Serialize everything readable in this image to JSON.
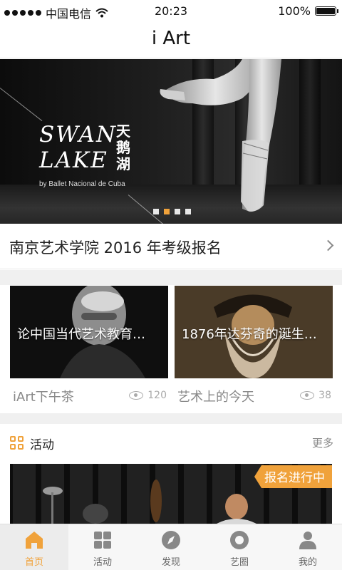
{
  "status_bar": {
    "carrier": "中国电信",
    "time": "20:23",
    "battery": "100%",
    "battery_level": 1.0
  },
  "nav": {
    "title": "i Art"
  },
  "banner": {
    "title_latin_line1": "SWAN",
    "title_latin_line2": "LAKE",
    "title_cn": "天鹅湖",
    "byline": "by Ballet Nacional de Cuba",
    "page_count": 4,
    "active_page": 2
  },
  "registration": {
    "text": "南京艺术学院  2016  年考级报名"
  },
  "cards": [
    {
      "overlay_title": "论中国当代艺术教育…",
      "category": "iArt下午茶",
      "views": "120"
    },
    {
      "overlay_title": "1876年达芬奇的诞生…",
      "category": "艺术上的今天",
      "views": "38"
    }
  ],
  "activity": {
    "title": "活动",
    "more": "更多",
    "badge": "报名进行中"
  },
  "tabs": [
    {
      "label": "首页",
      "icon": "home-icon",
      "active": true
    },
    {
      "label": "活动",
      "icon": "grid-icon",
      "active": false
    },
    {
      "label": "发现",
      "icon": "compass-icon",
      "active": false
    },
    {
      "label": "艺圈",
      "icon": "circle-icon",
      "active": false
    },
    {
      "label": "我的",
      "icon": "person-icon",
      "active": false
    }
  ],
  "colors": {
    "accent": "#f0a23b",
    "text_primary": "#222222",
    "text_secondary": "#888888",
    "divider": "#f0f0f0"
  }
}
